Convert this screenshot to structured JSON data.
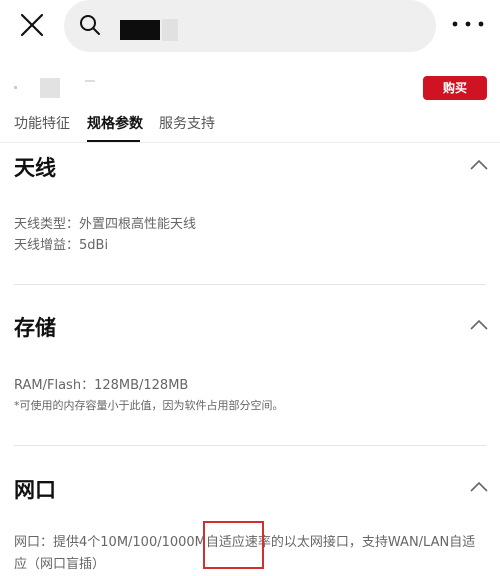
{
  "header": {
    "close_icon": "close-icon",
    "search_icon": "search-icon",
    "more_icon": "more-horizontal-icon"
  },
  "product": {
    "buy_label": "购买",
    "buy_color": "#cf1322"
  },
  "tabs": [
    {
      "label": "功能特征",
      "active": false
    },
    {
      "label": "规格参数",
      "active": true
    },
    {
      "label": "服务支持",
      "active": false
    }
  ],
  "sections": {
    "antenna": {
      "title": "天线",
      "lines": [
        "天线类型：外置四根高性能天线",
        "天线增益：5dBi"
      ]
    },
    "storage": {
      "title": "存储",
      "lines": [
        "RAM/Flash：128MB/128MB"
      ],
      "note": "*可使用的内存容量小于此值，因为软件占用部分空间。"
    },
    "port": {
      "title": "网口",
      "text": "网口：提供4个10M/100/1000M自适应速率的以太网接口，支持WAN/LAN自适应（网口盲插）"
    }
  },
  "annotation": {
    "highlight_color": "#d03030"
  }
}
